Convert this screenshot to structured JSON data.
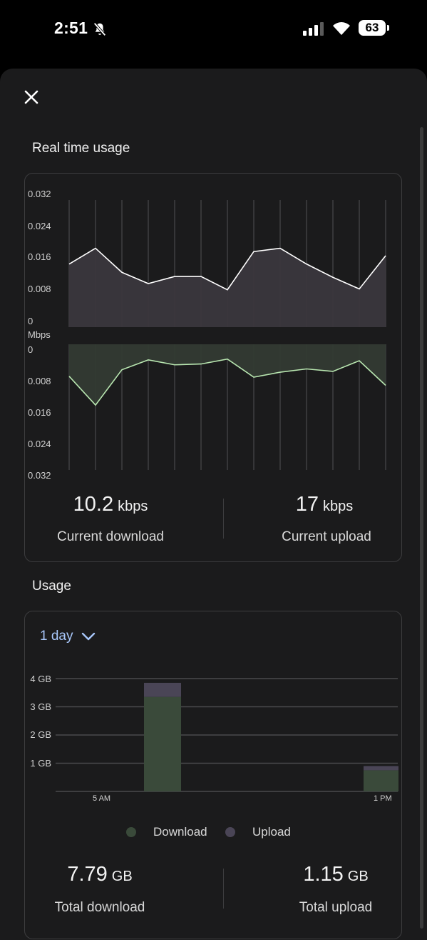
{
  "status": {
    "time": "2:51",
    "battery": "63"
  },
  "realtime": {
    "title": "Real time usage",
    "unit_label": "Mbps",
    "download_ticks": [
      "0.032",
      "0.024",
      "0.016",
      "0.008",
      "0"
    ],
    "upload_ticks": [
      "0",
      "0.008",
      "0.016",
      "0.024",
      "0.032"
    ],
    "current_download_value": "10.2",
    "current_download_unit": "kbps",
    "current_download_label": "Current download",
    "current_upload_value": "17",
    "current_upload_unit": "kbps",
    "current_upload_label": "Current upload"
  },
  "usage": {
    "title": "Usage",
    "range": "1 day",
    "total_download_value": "7.79",
    "total_download_unit": "GB",
    "total_download_label": "Total download",
    "total_upload_value": "1.15",
    "total_upload_unit": "GB",
    "total_upload_label": "Total upload"
  },
  "colors": {
    "download_line": "#ffffff",
    "download_fill": "#3a373d",
    "upload_line": "#b8e6b0",
    "upload_fill": "#333a33",
    "bar_download": "#3a4a3a",
    "bar_upload": "#4a4556",
    "accent": "#a8c7fa"
  },
  "chart_data": [
    {
      "type": "area",
      "ylabel": "Mbps",
      "ylim": [
        0,
        0.032
      ],
      "ticks": [
        0,
        0.008,
        0.016,
        0.024,
        0.032
      ],
      "series": [
        {
          "name": "Current download",
          "values": [
            0.0152,
            0.019,
            0.0132,
            0.0105,
            0.0122,
            0.0122,
            0.009,
            0.0182,
            0.019,
            0.0152,
            0.012,
            0.0092,
            0.0172
          ]
        }
      ]
    },
    {
      "type": "area",
      "ylabel": "Mbps",
      "ylim": [
        0,
        0.032
      ],
      "inverted": true,
      "ticks": [
        0,
        0.008,
        0.016,
        0.024,
        0.032
      ],
      "series": [
        {
          "name": "Current upload",
          "values": [
            0.0078,
            0.0148,
            0.0062,
            0.0038,
            0.005,
            0.0048,
            0.0036,
            0.008,
            0.0068,
            0.006,
            0.0066,
            0.004,
            0.01
          ]
        }
      ]
    },
    {
      "type": "bar",
      "stacked": true,
      "x_tick_labels": [
        "5 AM",
        "1 PM"
      ],
      "y_tick_labels": [
        "1 GB",
        "2 GB",
        "3 GB",
        "4 GB"
      ],
      "ylim": [
        0,
        4
      ],
      "grid": true,
      "legend": "bottom",
      "series_names": [
        "Download",
        "Upload"
      ],
      "bars": [
        {
          "download": 3.35,
          "upload": 0.5
        },
        {
          "download": 0.75,
          "upload": 0.15
        }
      ]
    }
  ]
}
